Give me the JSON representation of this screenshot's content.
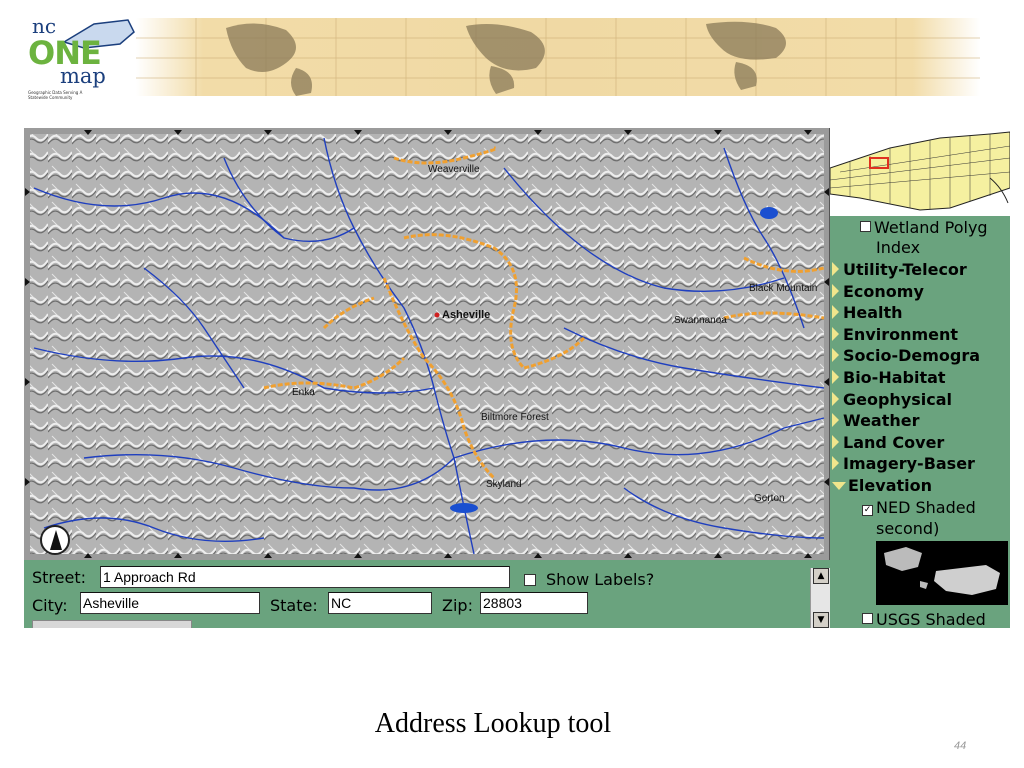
{
  "logo": {
    "nc": "nc",
    "one": "ONE",
    "map": "map",
    "tagline": "Geographic Data Serving A Statewide Community"
  },
  "map": {
    "places": [
      {
        "name": "Weaverville"
      },
      {
        "name": "Asheville"
      },
      {
        "name": "Black Mountain"
      },
      {
        "name": "Swannanoa"
      },
      {
        "name": "Enka"
      },
      {
        "name": "Biltmore Forest"
      },
      {
        "name": "Skyland"
      },
      {
        "name": "Gerton"
      }
    ],
    "colors": {
      "rivers": "#1f3fbf",
      "roads": "#f0a030",
      "relief": "#a8a8a8",
      "lakes": "#1a4fd0",
      "city_dot": "#d02020"
    }
  },
  "form": {
    "street_label": "Street:",
    "street_value": "1 Approach Rd",
    "show_labels_label": "Show Labels?",
    "city_label": "City:",
    "city_value": "Asheville",
    "state_label": "State:",
    "state_value": "NC",
    "zip_label": "Zip:",
    "zip_value": "28803"
  },
  "layers": {
    "wetland": "Wetland Polyg",
    "wetland_sub": "Index",
    "categories": [
      "Utility-Telecor",
      "Economy",
      "Health",
      "Environment",
      "Socio-Demogra",
      "Bio-Habitat",
      "Geophysical",
      "Weather",
      "Land Cover",
      "Imagery-Baser"
    ],
    "elevation": "Elevation",
    "ned": "NED Shaded",
    "ned_sub": "second)",
    "usgs": "USGS Shaded"
  },
  "footer": {
    "caption": "Address Lookup tool",
    "page_number": "44"
  },
  "theme": {
    "panel_green": "#6aa37e",
    "triangle": "#f0e68c"
  }
}
